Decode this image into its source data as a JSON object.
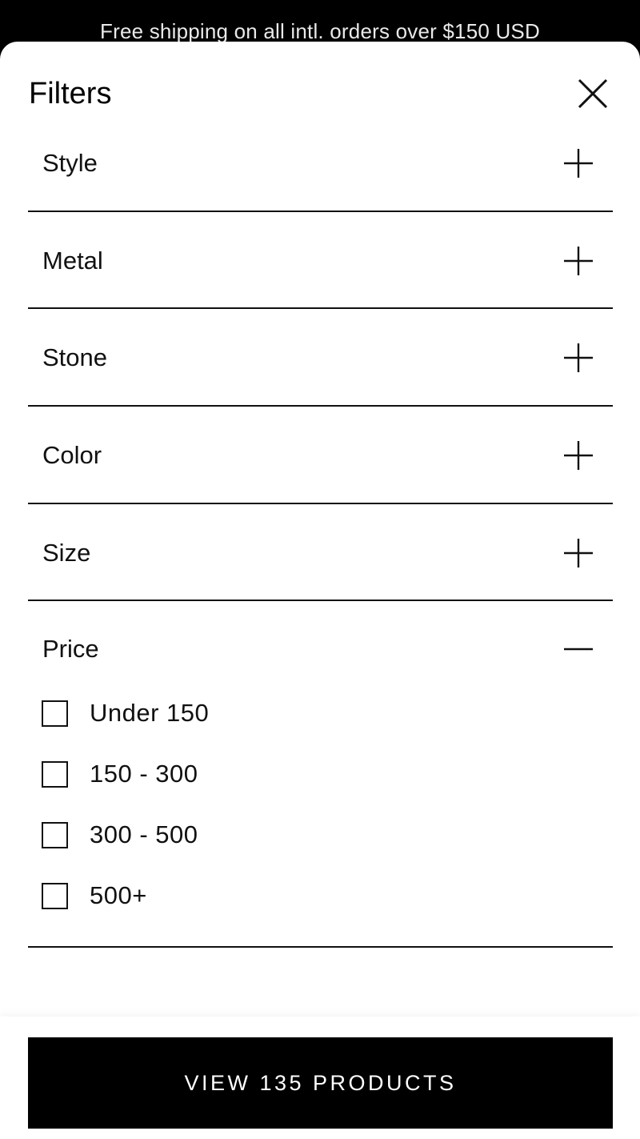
{
  "promo_bar": {
    "text": "Free shipping on all intl. orders over $150 USD"
  },
  "panel": {
    "title": "Filters",
    "close_icon": "close-icon"
  },
  "filters": [
    {
      "label": "Style",
      "expanded": false,
      "icon": "plus-icon"
    },
    {
      "label": "Metal",
      "expanded": false,
      "icon": "plus-icon"
    },
    {
      "label": "Stone",
      "expanded": false,
      "icon": "plus-icon"
    },
    {
      "label": "Color",
      "expanded": false,
      "icon": "plus-icon"
    },
    {
      "label": "Size",
      "expanded": false,
      "icon": "plus-icon"
    },
    {
      "label": "Price",
      "expanded": true,
      "icon": "minus-icon",
      "options": [
        {
          "label": "Under 150",
          "checked": false
        },
        {
          "label": "150 - 300",
          "checked": false
        },
        {
          "label": "300 - 500",
          "checked": false
        },
        {
          "label": "500+",
          "checked": false
        }
      ]
    }
  ],
  "footer": {
    "button_label": "VIEW 135 PRODUCTS"
  },
  "colors": {
    "background": "#000000",
    "panel": "#ffffff",
    "text": "#111111",
    "button": "#000000",
    "button_text": "#ffffff"
  }
}
